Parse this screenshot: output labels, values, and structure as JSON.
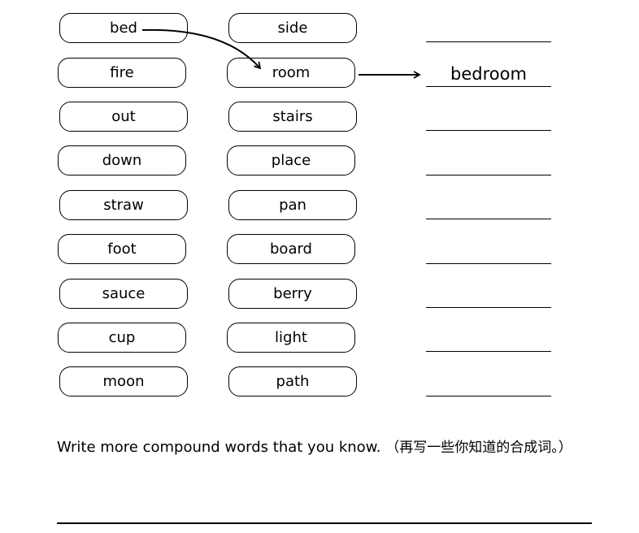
{
  "left_words": [
    "bed",
    "fire",
    "out",
    "down",
    "straw",
    "foot",
    "sauce",
    "cup",
    "moon"
  ],
  "right_words": [
    "side",
    "room",
    "stairs",
    "place",
    "pan",
    "board",
    "berry",
    "light",
    "path"
  ],
  "answers": [
    "",
    "bedroom",
    "",
    "",
    "",
    "",
    "",
    "",
    ""
  ],
  "instruction": {
    "english": "Write more compound words that you know.",
    "chinese": "（再写一些你知道的合成词。）"
  }
}
